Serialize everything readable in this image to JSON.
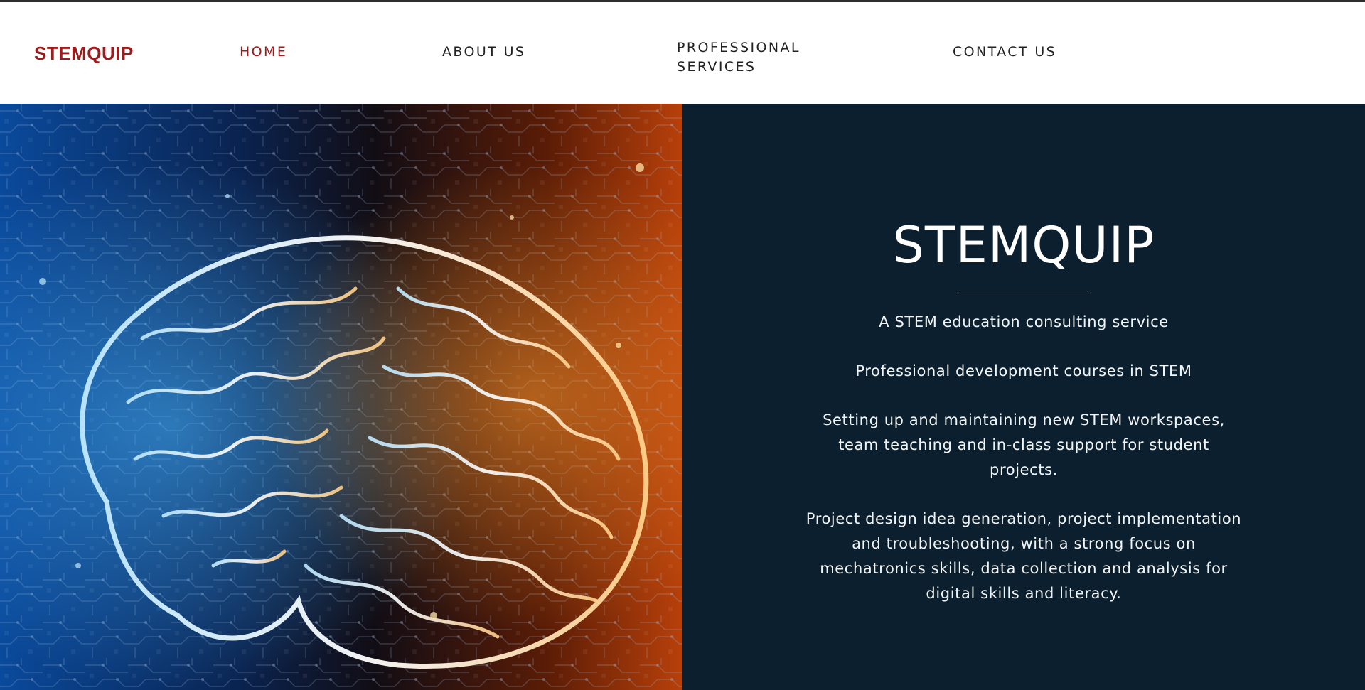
{
  "brand": "STEMQUIP",
  "nav": {
    "home": "HOME",
    "about": "ABOUT US",
    "professional": "PROFESSIONAL SERVICES",
    "contact": "CONTACT US"
  },
  "hero": {
    "image_subject": "glowing-brain-circuit",
    "title": "STEMQUIP",
    "paragraphs": [
      "A STEM education consulting service",
      "Professional development courses in STEM",
      "Setting up and maintaining new STEM workspaces, team teaching and in-class support for student projects.",
      "Project design idea generation, project implementation and troubleshooting, with a strong focus on mechatronics skills, data collection and analysis for digital skills and literacy."
    ]
  },
  "colors": {
    "brand_red": "#9b1c1c",
    "panel_navy": "#0c1f2e",
    "header_bg": "#ffffff"
  }
}
